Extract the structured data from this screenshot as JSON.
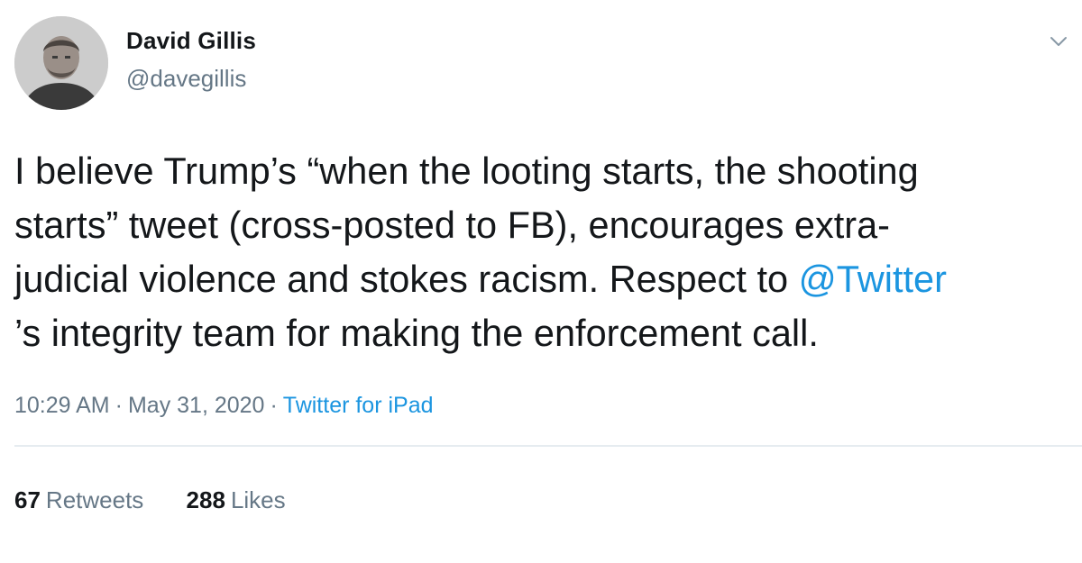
{
  "tweet": {
    "author": {
      "name": "David Gillis",
      "handle": "@davegillis",
      "avatar_icon": "avatar-photo"
    },
    "body": {
      "line1": "I believe Trump’s “when the looting starts, the shooting",
      "line2": "starts” tweet (cross-posted to FB), encourages extra-",
      "line3_prefix": "judicial violence and stokes racism. Respect to ",
      "mention": "@Twitter",
      "line4": "’s integrity team for making the enforcement call."
    },
    "meta": {
      "time": "10:29 AM",
      "date": "May 31, 2020",
      "separator": "·",
      "source": "Twitter for iPad"
    },
    "stats": {
      "retweets_count": "67",
      "retweets_label": "Retweets",
      "likes_count": "288",
      "likes_label": "Likes"
    },
    "menu_icon": "chevron-down-icon"
  },
  "colors": {
    "text": "#14171a",
    "secondary": "#657786",
    "link": "#1b95e0",
    "divider": "#e6ecf0"
  }
}
